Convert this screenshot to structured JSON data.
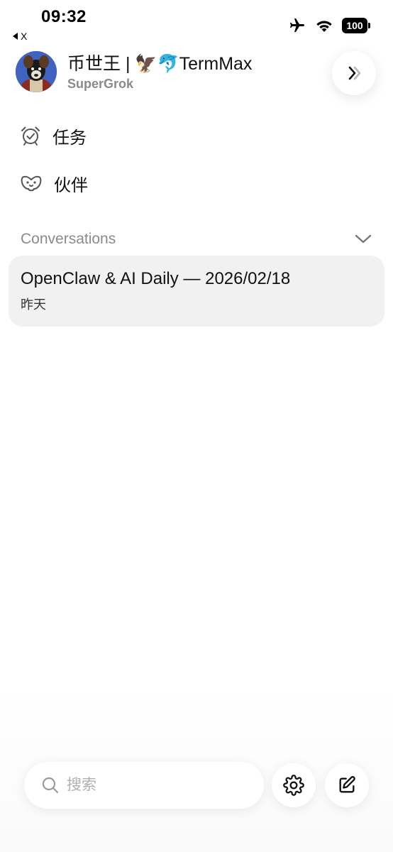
{
  "status_bar": {
    "time": "09:32",
    "back_app": "X",
    "battery": "100",
    "icons": [
      "airplane-icon",
      "wifi-icon",
      "battery-icon"
    ]
  },
  "profile": {
    "name": "币世王 | 🦅🐬TermMax",
    "subscription": "SuperGrok"
  },
  "menu": [
    {
      "label": "任务",
      "icon": "alarm-clock-icon"
    },
    {
      "label": "伙伴",
      "icon": "companions-icon"
    }
  ],
  "conversations": {
    "header": "Conversations",
    "items": [
      {
        "title": "OpenClaw & AI Daily — 2026/02/18",
        "time": "昨天"
      }
    ]
  },
  "search": {
    "placeholder": "搜索",
    "value": ""
  },
  "colors": {
    "background": "#ffffff",
    "conversation_bg": "#f1f1f2",
    "muted_text": "#8a8a8a",
    "avatar_bg": "#3f63c0"
  }
}
